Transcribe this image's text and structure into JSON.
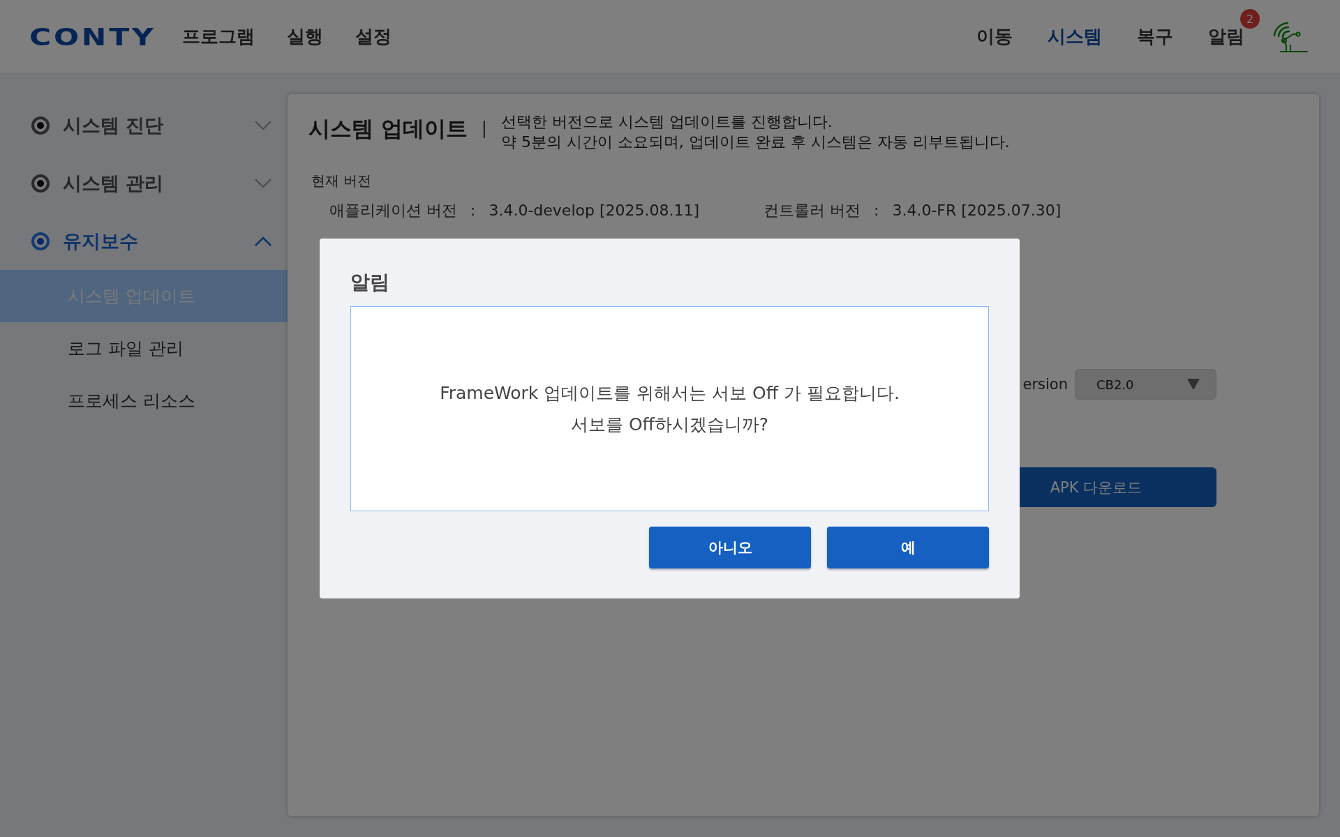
{
  "header": {
    "logo": "CONTY",
    "menu": [
      {
        "label": "프로그램"
      },
      {
        "label": "실행"
      },
      {
        "label": "설정"
      }
    ],
    "right_menu": [
      {
        "label": "이동",
        "selected": false
      },
      {
        "label": "시스템",
        "selected": true
      },
      {
        "label": "복구",
        "selected": false
      },
      {
        "label": "알림",
        "selected": false,
        "badge": "2"
      }
    ]
  },
  "sidebar": {
    "groups": [
      {
        "label": "시스템 진단",
        "selected": false,
        "expanded": false
      },
      {
        "label": "시스템 관리",
        "selected": false,
        "expanded": false
      },
      {
        "label": "유지보수",
        "selected": true,
        "expanded": true,
        "children": [
          {
            "label": "시스템 업데이트",
            "selected": true
          },
          {
            "label": "로그 파일 관리",
            "selected": false
          },
          {
            "label": "프로세스 리소스",
            "selected": false
          }
        ]
      }
    ]
  },
  "content": {
    "title": "시스템 업데이트",
    "separator": "|",
    "description": [
      "선택한 버전으로 시스템 업데이트를 진행합니다.",
      "약 5분의 시간이 소요되며, 업데이트 완료 후 시스템은 자동 리부트됩니다."
    ],
    "current_version_label": "현재 버전",
    "versions": [
      {
        "label": "애플리케이션 버전",
        "separator": ":",
        "value": "3.4.0-develop [2025.08.11]"
      },
      {
        "label": "컨트롤러 버전",
        "separator": ":",
        "value": "3.4.0-FR [2025.07.30]"
      }
    ],
    "version_label": "ersion",
    "version_select": {
      "value": "CB2.0"
    },
    "download_button": "APK 다운로드"
  },
  "dialog": {
    "title": "알림",
    "message": [
      "FrameWork 업데이트를 위해서는 서보 Off 가 필요합니다.",
      "서보를 Off하시겠습니까?"
    ],
    "buttons": [
      "아니오",
      "예"
    ]
  }
}
